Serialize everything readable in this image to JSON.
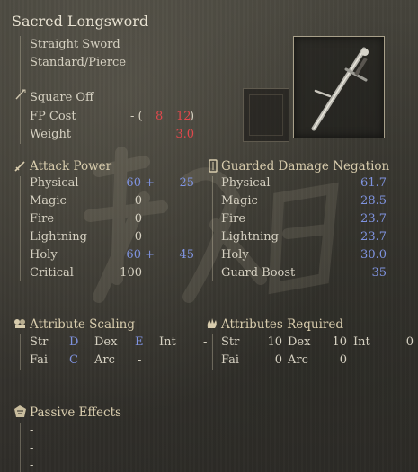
{
  "item": {
    "name": "Sacred Longsword",
    "weapon_type": "Straight Sword",
    "damage_type": "Standard/Pierce",
    "skill": "Square Off",
    "fp_label": "FP Cost",
    "fp_open": "- (",
    "fp_value1": "8",
    "fp_value2": "12",
    "fp_close": ")",
    "weight_label": "Weight",
    "weight_value": "3.0"
  },
  "attack_power": {
    "header": "Attack Power",
    "rows": [
      {
        "label": "Physical",
        "base": "60 +",
        "bonus": "25"
      },
      {
        "label": "Magic",
        "base": "0",
        "bonus": ""
      },
      {
        "label": "Fire",
        "base": "0",
        "bonus": ""
      },
      {
        "label": "Lightning",
        "base": "0",
        "bonus": ""
      },
      {
        "label": "Holy",
        "base": "60 +",
        "bonus": "45"
      },
      {
        "label": "Critical",
        "base": "100",
        "bonus": ""
      }
    ]
  },
  "guarded": {
    "header": "Guarded Damage Negation",
    "rows": [
      {
        "label": "Physical",
        "value": "61.7"
      },
      {
        "label": "Magic",
        "value": "28.5"
      },
      {
        "label": "Fire",
        "value": "23.7"
      },
      {
        "label": "Lightning",
        "value": "23.7"
      },
      {
        "label": "Holy",
        "value": "30.0"
      },
      {
        "label": "Guard Boost",
        "value": "35"
      }
    ]
  },
  "scaling": {
    "header": "Attribute Scaling",
    "str_label": "Str",
    "str_value": "D",
    "dex_label": "Dex",
    "dex_value": "E",
    "int_label": "Int",
    "int_value": "-",
    "fai_label": "Fai",
    "fai_value": "C",
    "arc_label": "Arc",
    "arc_value": "-"
  },
  "required": {
    "header": "Attributes Required",
    "str_label": "Str",
    "str_value": "10",
    "dex_label": "Dex",
    "dex_value": "10",
    "int_label": "Int",
    "int_value": "0",
    "fai_label": "Fai",
    "fai_value": "0",
    "arc_label": "Arc",
    "arc_value": "0"
  },
  "passive": {
    "header": "Passive Effects",
    "lines": [
      "-",
      "-",
      "-"
    ]
  },
  "colors": {
    "accent_blue": "#7f93e0",
    "accent_red": "#e0484c",
    "text": "#d6d1c2",
    "header": "#d8ccad"
  },
  "icons": [
    "sword-icon",
    "shield-icon",
    "scaling-icon",
    "hand-icon",
    "passive-icon",
    "weapon-image",
    "ash-of-war-slot"
  ]
}
